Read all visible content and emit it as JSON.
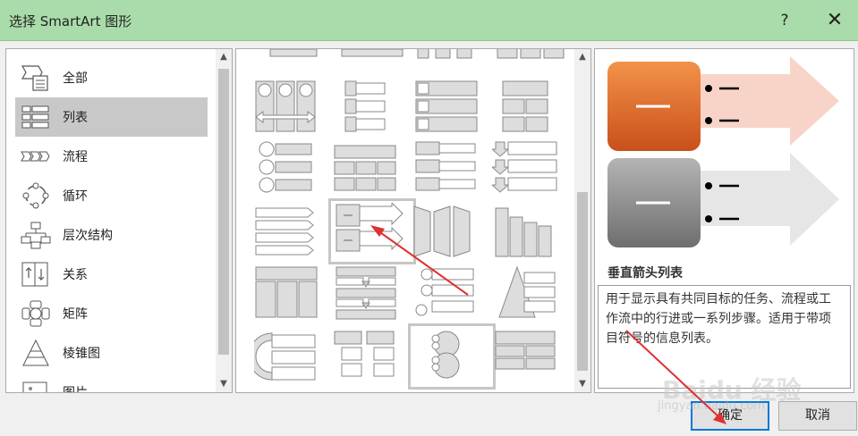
{
  "window": {
    "title": "选择 SmartArt 图形",
    "help_label": "?",
    "close_label": "✕"
  },
  "categories": [
    {
      "label": "全部",
      "icon": "all-icon",
      "selected": false
    },
    {
      "label": "列表",
      "icon": "list-icon",
      "selected": true
    },
    {
      "label": "流程",
      "icon": "process-icon",
      "selected": false
    },
    {
      "label": "循环",
      "icon": "cycle-icon",
      "selected": false
    },
    {
      "label": "层次结构",
      "icon": "hierarchy-icon",
      "selected": false
    },
    {
      "label": "关系",
      "icon": "relationship-icon",
      "selected": false
    },
    {
      "label": "矩阵",
      "icon": "matrix-icon",
      "selected": false
    },
    {
      "label": "棱锥图",
      "icon": "pyramid-icon",
      "selected": false
    },
    {
      "label": "图片",
      "icon": "picture-icon",
      "selected": false
    }
  ],
  "preview": {
    "title": "垂直箭头列表",
    "description": "用于显示具有共同目标的任务、流程或工作流中的行进或一系列步骤。适用于带项目符号的信息列表。",
    "accent_color": "#e0661f",
    "secondary_color": "#8c8c8c",
    "arrow_color": "#f8d4c8"
  },
  "buttons": {
    "ok_label": "确定",
    "cancel_label": "取消"
  },
  "watermark": {
    "text": "Baidu 经验",
    "sub": "jingyan.baidu.com"
  },
  "annotation_color": "#e03030"
}
